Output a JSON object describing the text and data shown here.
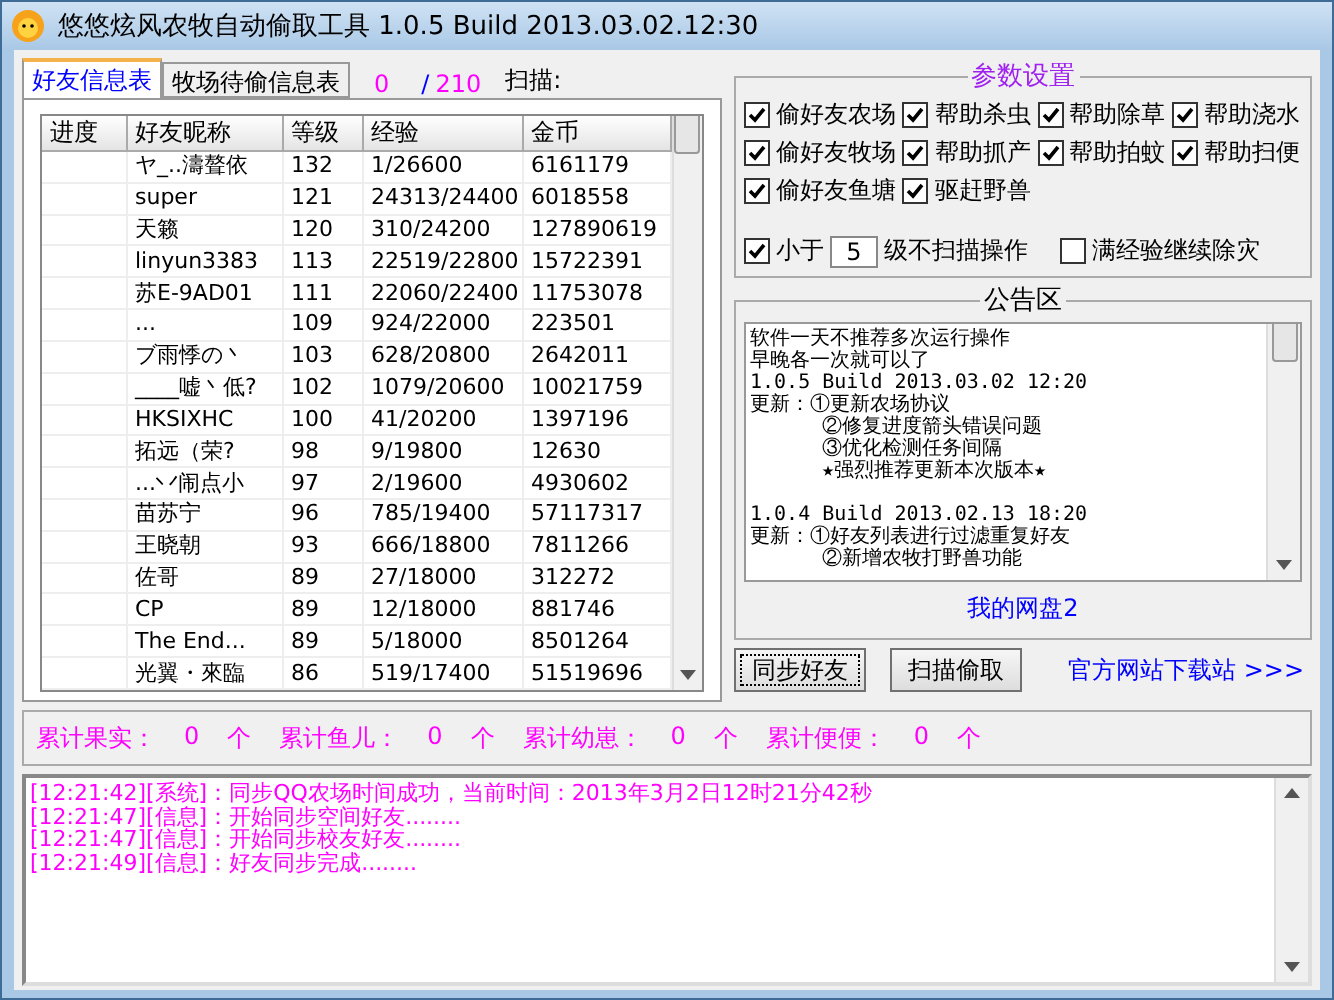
{
  "window": {
    "title": "悠悠炫风农牧自动偷取工具 1.0.5 Build 2013.03.02.12:30"
  },
  "tabs": [
    {
      "label": "好友信息表",
      "selected": true
    },
    {
      "label": "牧场待偷信息表",
      "selected": false
    }
  ],
  "progress": {
    "done": "0",
    "separator": "/",
    "total": "210",
    "scan_label": "扫描:"
  },
  "table": {
    "columns": [
      "进度",
      "好友昵称",
      "等级",
      "经验",
      "金币"
    ],
    "rows": [
      [
        "",
        "ヤ_..濤聱依",
        "132",
        "1/26600",
        "6161179"
      ],
      [
        "",
        "super",
        "121",
        "24313/24400",
        "6018558"
      ],
      [
        "",
        "天籁",
        "120",
        "310/24200",
        "127890619"
      ],
      [
        "",
        "linyun3383",
        "113",
        "22519/22800",
        "15722391"
      ],
      [
        "",
        "苏E-9AD01",
        "111",
        "22060/22400",
        "11753078"
      ],
      [
        "",
        "...",
        "109",
        "924/22000",
        "223501"
      ],
      [
        "",
        "ブ雨悸の丶",
        "103",
        "628/20800",
        "2642011"
      ],
      [
        "",
        "____嘘丶低?",
        "102",
        "1079/20600",
        "10021759"
      ],
      [
        "",
        "HKSIXHC",
        "100",
        "41/20200",
        "1397196"
      ],
      [
        "",
        "拓远（荣?",
        "98",
        "9/19800",
        "12630"
      ],
      [
        "",
        "...丷闹点小",
        "97",
        "2/19600",
        "4930602"
      ],
      [
        "",
        "苗苏宁",
        "96",
        "785/19400",
        "57117317"
      ],
      [
        "",
        "王晓朝",
        "93",
        "666/18800",
        "7811266"
      ],
      [
        "",
        "佐哥",
        "89",
        "27/18000",
        "312272"
      ],
      [
        "",
        "CP",
        "89",
        "12/18000",
        "881746"
      ],
      [
        "",
        "The End...",
        "89",
        "5/18000",
        "8501264"
      ],
      [
        "",
        "光翼・來臨",
        "86",
        "519/17400",
        "51519696"
      ]
    ]
  },
  "settings": {
    "title": "参数设置",
    "options": [
      {
        "label": "偷好友农场",
        "checked": true
      },
      {
        "label": "帮助杀虫",
        "checked": true
      },
      {
        "label": "帮助除草",
        "checked": true
      },
      {
        "label": "帮助浇水",
        "checked": true
      },
      {
        "label": "偷好友牧场",
        "checked": true
      },
      {
        "label": "帮助抓产",
        "checked": true
      },
      {
        "label": "帮助拍蚊",
        "checked": true
      },
      {
        "label": "帮助扫便",
        "checked": true
      },
      {
        "label": "偷好友鱼塘",
        "checked": true
      },
      {
        "label": "驱赶野兽",
        "checked": true
      }
    ],
    "level_limit": {
      "checked": true,
      "prefix": "小于",
      "value": "5",
      "suffix": "级不扫描操作"
    },
    "keep_clearing": {
      "checked": false,
      "label": "满经验继续除灾"
    }
  },
  "notice": {
    "title": "公告区",
    "blocks": [
      {
        "lines": [
          {
            "text": "软件一天不推荐多次运行操作",
            "indent": false
          },
          {
            "text": "早晚各一次就可以了",
            "indent": false
          },
          {
            "text": "1.0.5 Build 2013.03.02 12:20",
            "indent": false
          },
          {
            "text": "更新：①更新农场协议",
            "indent": false
          },
          {
            "text": "②修复进度箭头错误问题",
            "indent": true
          },
          {
            "text": "③优化检测任务间隔",
            "indent": true
          },
          {
            "text": "★强烈推荐更新本次版本★",
            "indent": true
          }
        ]
      },
      {
        "lines": [
          {
            "text": "1.0.4 Build 2013.02.13 18:20",
            "indent": false
          },
          {
            "text": "更新：①好友列表进行过滤重复好友",
            "indent": false
          },
          {
            "text": "②新增农牧打野兽功能",
            "indent": true
          }
        ]
      }
    ],
    "link": "我的网盘2"
  },
  "buttons": [
    {
      "label": "同步好友",
      "focused": true
    },
    {
      "label": "扫描偷取",
      "focused": false
    }
  ],
  "download_link": "官方网站下载站 >>>",
  "stats": [
    {
      "label": "累计果实：",
      "value": "0",
      "unit": "个"
    },
    {
      "label": "累计鱼儿：",
      "value": "0",
      "unit": "个"
    },
    {
      "label": "累计幼崽：",
      "value": "0",
      "unit": "个"
    },
    {
      "label": "累计便便：",
      "value": "0",
      "unit": "个"
    }
  ],
  "log": [
    "[12:21:42][系统]：同步QQ农场时间成功，当前时间：2013年3月2日12时21分42秒",
    "[12:21:47][信息]：开始同步空间好友........",
    "[12:21:47][信息]：开始同步校友好友........",
    "[12:21:49][信息]：好友同步完成........"
  ]
}
